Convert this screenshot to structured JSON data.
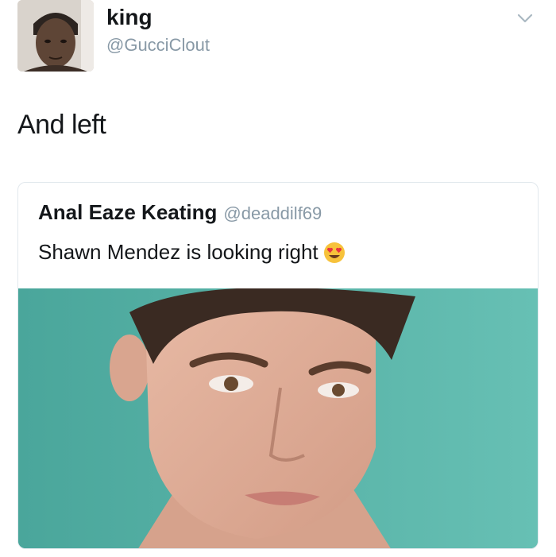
{
  "tweet": {
    "author": {
      "display_name": "king",
      "handle": "@GucciClout",
      "avatar_icon": "profile-photo"
    },
    "menu_icon": "chevron-down-icon",
    "text": "And left",
    "quoted": {
      "display_name": "Anal Eaze Keating",
      "handle": "@deaddilf69",
      "text": "Shawn Mendez is looking right",
      "emoji": "heart-eyes-emoji",
      "media": "portrait-photo"
    }
  },
  "colors": {
    "text_primary": "#14171a",
    "text_secondary": "#8899a6",
    "border": "#e1e8ed",
    "media_background": "#5fb5a9",
    "chevron": "#aab8c2"
  }
}
